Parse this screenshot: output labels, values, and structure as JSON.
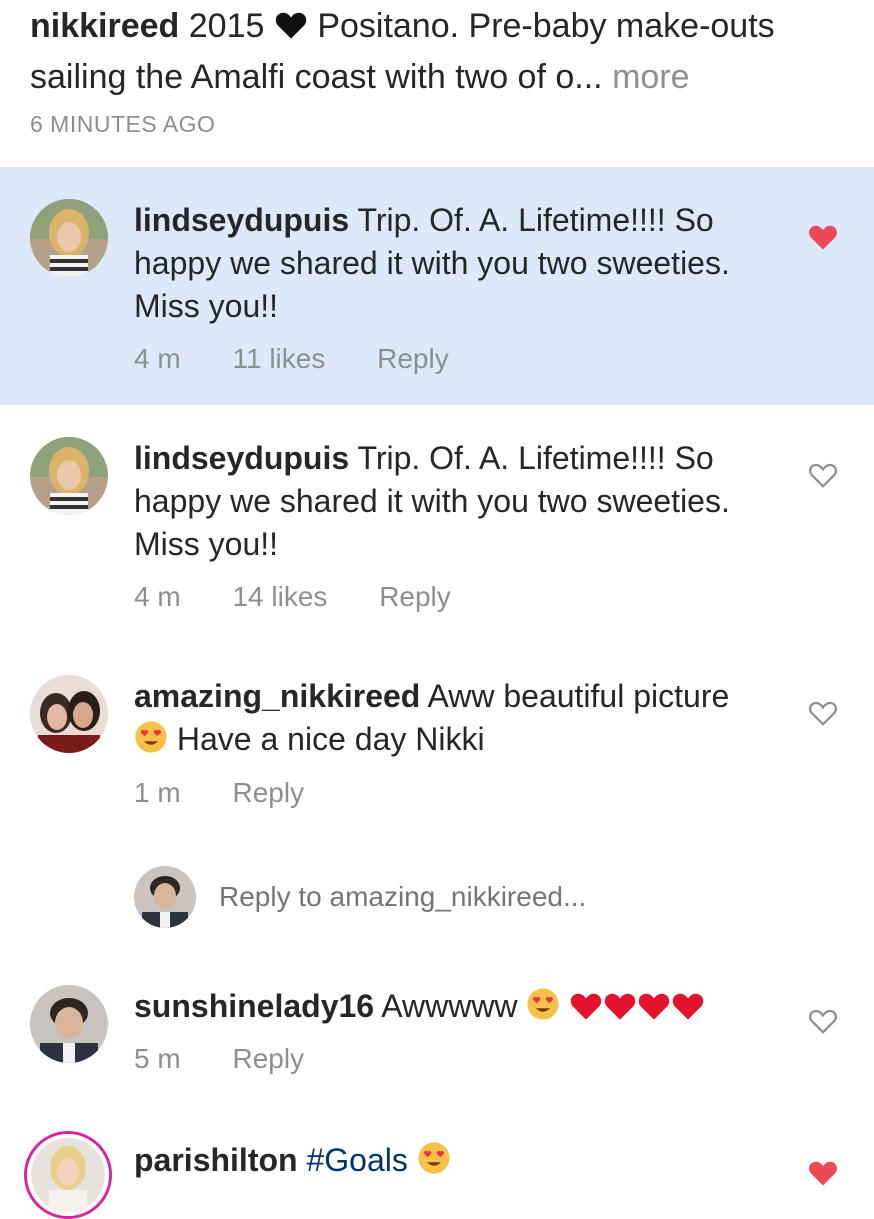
{
  "caption": {
    "username": "nikkireed",
    "text_before_heart": "2015",
    "text_after_heart": "Positano. Pre-baby make-outs sailing the Amalfi coast with two of o...",
    "more_label": "more",
    "time_ago": "6 MINUTES AGO"
  },
  "comments": [
    {
      "username": "lindseydupuis",
      "text": "Trip. Of. A. Lifetime!!!! So happy we shared it with you two sweeties. Miss you!!",
      "time": "4 m",
      "likes": "11 likes",
      "reply_label": "Reply",
      "liked": true
    },
    {
      "username": "lindseydupuis",
      "text": "Trip. Of. A. Lifetime!!!! So happy we shared it with you two sweeties. Miss you!!",
      "time": "4 m",
      "likes": "14 likes",
      "reply_label": "Reply",
      "liked": false
    },
    {
      "username": "amazing_nikkireed",
      "text_before_emoji": "Aww beautiful picture",
      "text_after_emoji": "Have a nice day Nikki",
      "time": "1 m",
      "reply_label": "Reply",
      "liked": false
    },
    {
      "username": "sunshinelady16",
      "text": "Awwwww",
      "time": "5 m",
      "reply_label": "Reply",
      "liked": false
    },
    {
      "username": "parishilton",
      "hashtag": "#Goals",
      "liked": true
    }
  ],
  "reply_box": {
    "placeholder": "Reply to amazing_nikkireed..."
  },
  "colors": {
    "highlight_bg": "#dbe9fb",
    "like_red": "#ed4956",
    "meta_gray": "#8e8e8e",
    "hashtag_blue": "#003569"
  }
}
